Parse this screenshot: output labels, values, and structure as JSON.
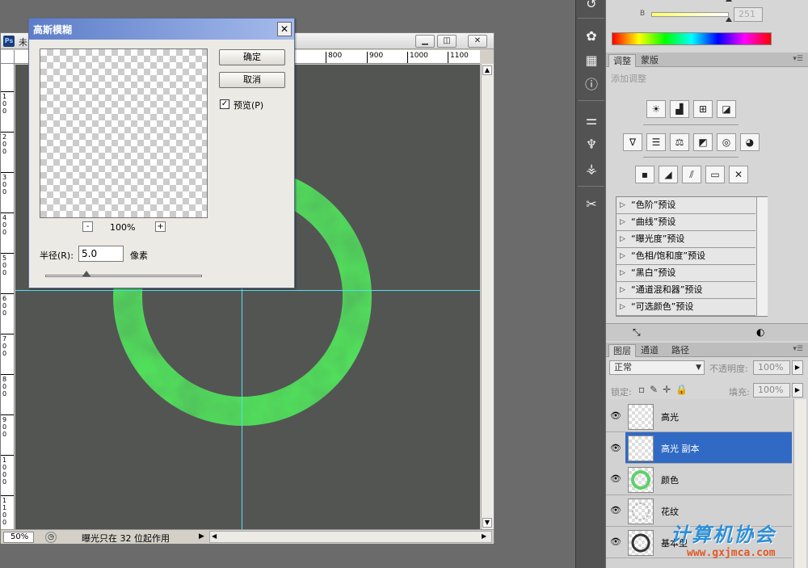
{
  "document": {
    "title": "未",
    "ps_badge": "Ps",
    "minimize": "▁",
    "restore": "◫",
    "close": "✕",
    "ruler_ticks": [
      "800",
      "900",
      "1000",
      "1100"
    ],
    "vruler_ticks": [
      "1\n0\n0",
      "2\n0\n0",
      "3\n0\n0",
      "4\n0\n0",
      "5\n0\n0",
      "6\n0\n0",
      "7\n0\n0",
      "8\n0\n0",
      "9\n0\n0",
      "1\n0\n0\n0",
      "1\n1\n0\n0"
    ],
    "zoom": "50%",
    "status": "曝光只在 32 位起作用"
  },
  "dialog": {
    "title": "高斯模糊",
    "close": "✕",
    "ok": "确定",
    "cancel": "取消",
    "preview_label": "预览(P)",
    "preview_checked": true,
    "zoom_out": "-",
    "zoom_in": "+",
    "zoom_level": "100%",
    "radius_label": "半径(R):",
    "radius_value": "5.0",
    "radius_unit": "像素"
  },
  "tools": [
    "✿",
    "▦",
    "ⓘ",
    "⚌",
    "♆",
    "⚶",
    "✂"
  ],
  "color_panel": {
    "channel_label": "B",
    "channel_value": "251",
    "colors": {
      "ramp_start": "#ff0000",
      "slider_yellow": "#ffff66"
    }
  },
  "adjust_panel": {
    "tabs": [
      "调整",
      "蒙版"
    ],
    "add_label": "添加调整",
    "row1": [
      "☀",
      "▟",
      "⊞",
      "◪"
    ],
    "row2": [
      "∇",
      "☰",
      "⚖",
      "◩",
      "◎",
      "◕"
    ],
    "row3": [
      "▪",
      "◢",
      "⫽",
      "▭",
      "✕"
    ],
    "presets": [
      "“色阶”预设",
      "“曲线”预设",
      "“曝光度”预设",
      "“色相/饱和度”预设",
      "“黑白”预设",
      "“通道混和器”预设",
      "“可选颜色”预设"
    ]
  },
  "layers_panel": {
    "tabs": [
      "图层",
      "通道",
      "路径"
    ],
    "blend_mode": "正常",
    "opacity_label": "不透明度:",
    "opacity_value": "100%",
    "lock_label": "锁定:",
    "fill_label": "填充:",
    "fill_value": "100%",
    "eye": "👁",
    "layers": [
      {
        "name": "高光",
        "selected": false
      },
      {
        "name": "高光 副本",
        "selected": true
      },
      {
        "name": "颜色",
        "selected": false
      },
      {
        "name": "花纹",
        "selected": false
      },
      {
        "name": "基本型",
        "selected": false
      }
    ]
  },
  "watermark": {
    "title": "计算机协会",
    "url": "www.gxjmca.com"
  }
}
